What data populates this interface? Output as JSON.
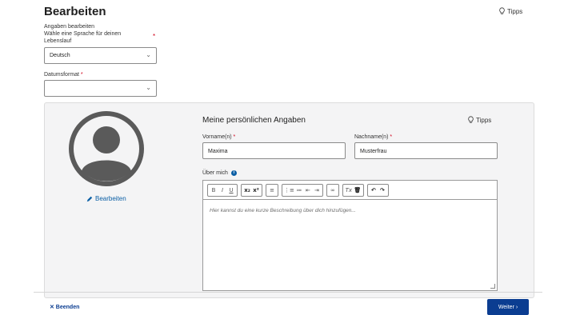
{
  "header": {
    "title": "Bearbeiten",
    "tips_label": "Tipps"
  },
  "form": {
    "section_label": "Angaben bearbeiten",
    "language_label": "Wähle eine Sprache für deinen Lebenslauf",
    "language_required": "*",
    "language_value": "Deutsch",
    "date_format_label": "Datumsformat",
    "date_format_required": "*",
    "date_format_value": ""
  },
  "profile": {
    "edit_label": "Bearbeiten",
    "section_title": "Meine persönlichen Angaben",
    "tips_label": "Tipps",
    "first_name_label": "Vorname(n)",
    "first_name_required": "*",
    "first_name_value": "Maxima",
    "last_name_label": "Nachname(n)",
    "last_name_required": "*",
    "last_name_value": "Musterfrau",
    "about_label": "Über mich",
    "about_info_icon": "i",
    "about_placeholder": "Hier kannst du eine kurze Beschreibung über dich hinzufügen..."
  },
  "toolbar": {
    "bold": "B",
    "italic": "I",
    "underline": "U",
    "subscript": "x₂",
    "superscript": "x²",
    "align": "≡",
    "ordered_list": "⋮≡",
    "unordered_list": "≔",
    "outdent": "⇤",
    "indent": "⇥",
    "link": "∞",
    "clear_format": "Tx",
    "delete": "🗑",
    "undo": "↶",
    "redo": "↷"
  },
  "footer": {
    "cancel_label": "✕ Beenden",
    "next_label": "Weiter ›"
  },
  "colors": {
    "primary": "#0b3d91",
    "link": "#0b5fa5",
    "required": "#d0021b",
    "avatar": "#5a5a5a"
  }
}
